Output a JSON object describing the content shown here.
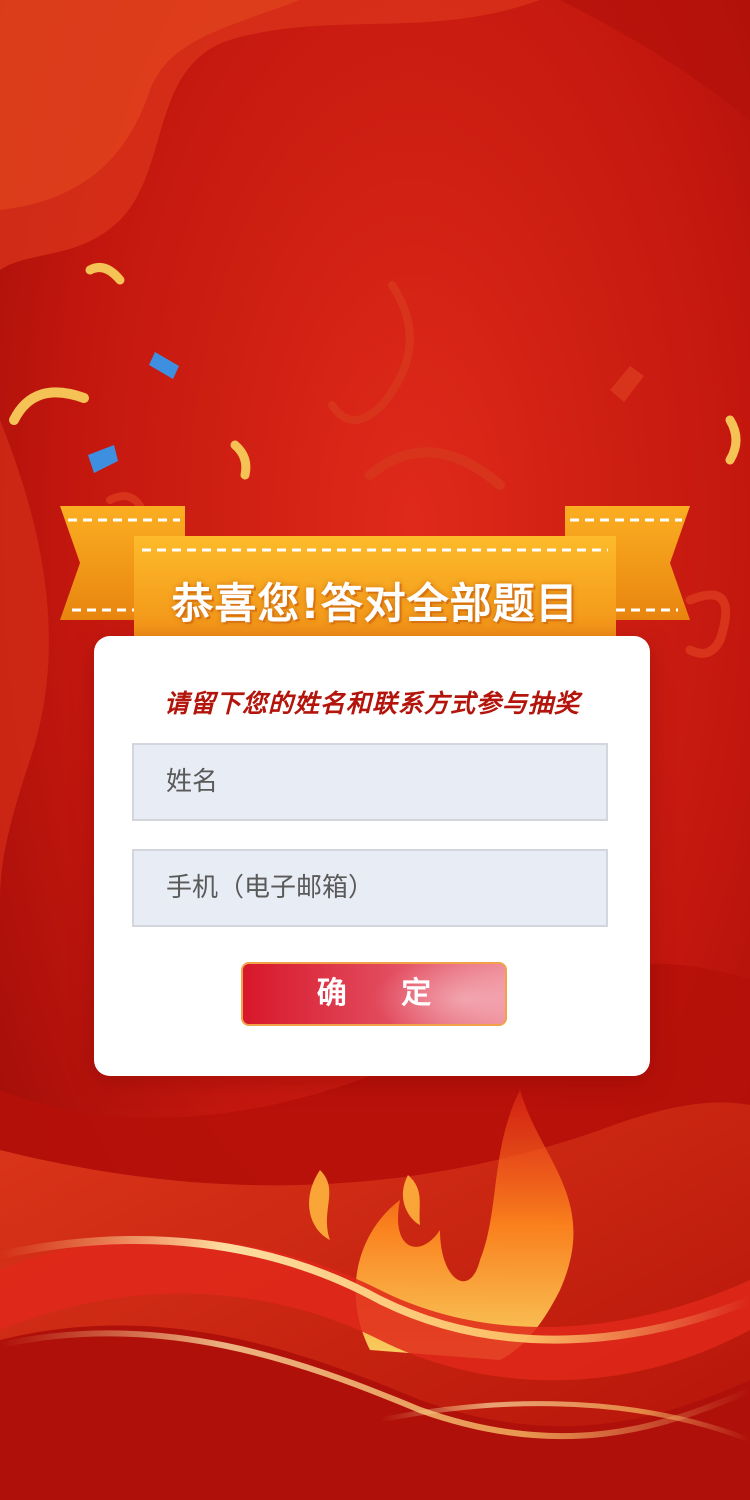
{
  "banner": {
    "title": "恭喜您!答对全部题目"
  },
  "form": {
    "subtitle": "请留下您的姓名和联系方式参与抽奖",
    "name_placeholder": "姓名",
    "contact_placeholder": "手机（电子邮箱）",
    "submit_label": "确 定"
  },
  "theme": {
    "background_red": "#c0160f",
    "banner_orange": "#f7a21b",
    "subtitle_red": "#b3150c",
    "button_red": "#d8172a",
    "card_white": "#ffffff"
  },
  "decor": {
    "confetti_icon": "confetti-icon",
    "flame_icon": "flame-icon",
    "ribbon_icon": "ribbon-icon"
  }
}
